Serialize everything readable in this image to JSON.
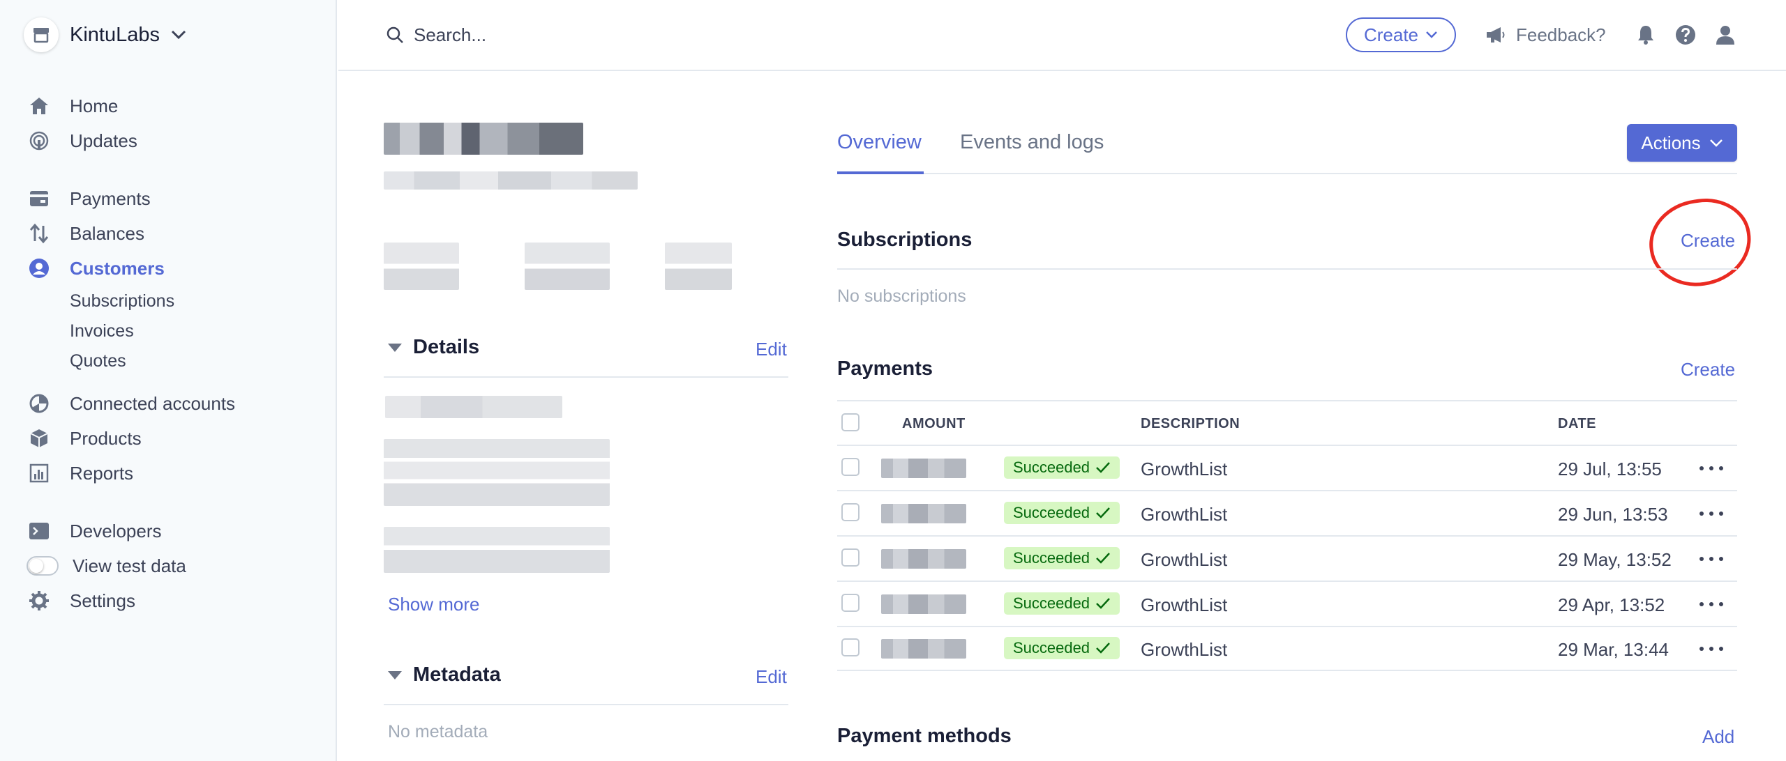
{
  "account": {
    "name": "KintuLabs"
  },
  "nav": {
    "primary": [
      {
        "label": "Home",
        "icon": "home-icon"
      },
      {
        "label": "Updates",
        "icon": "updates-icon"
      }
    ],
    "secondary": [
      {
        "label": "Payments",
        "icon": "payments-icon"
      },
      {
        "label": "Balances",
        "icon": "balances-icon"
      },
      {
        "label": "Customers",
        "icon": "customers-icon",
        "active": true
      }
    ],
    "customers_sub": [
      "Subscriptions",
      "Invoices",
      "Quotes"
    ],
    "tertiary": [
      {
        "label": "Connected accounts",
        "icon": "connected-accounts-icon"
      },
      {
        "label": "Products",
        "icon": "products-icon"
      },
      {
        "label": "Reports",
        "icon": "reports-icon"
      }
    ],
    "bottom": [
      {
        "label": "Developers",
        "icon": "developers-icon"
      },
      {
        "label": "View test data",
        "icon": "toggle"
      },
      {
        "label": "Settings",
        "icon": "gear-icon"
      }
    ]
  },
  "topbar": {
    "search_placeholder": "Search...",
    "create_label": "Create",
    "feedback_label": "Feedback?"
  },
  "customer": {
    "details": {
      "title": "Details",
      "edit": "Edit",
      "show_more": "Show more"
    },
    "metadata": {
      "title": "Metadata",
      "edit": "Edit",
      "empty": "No metadata"
    }
  },
  "tabs": [
    {
      "label": "Overview",
      "active": true
    },
    {
      "label": "Events and logs",
      "active": false
    }
  ],
  "actions_label": "Actions",
  "subscriptions": {
    "title": "Subscriptions",
    "create": "Create",
    "empty": "No subscriptions"
  },
  "payments": {
    "title": "Payments",
    "create": "Create",
    "columns": [
      "AMOUNT",
      "DESCRIPTION",
      "DATE"
    ],
    "rows": [
      {
        "status": "Succeeded",
        "description": "GrowthList",
        "date": "29 Jul, 13:55"
      },
      {
        "status": "Succeeded",
        "description": "GrowthList",
        "date": "29 Jun, 13:53"
      },
      {
        "status": "Succeeded",
        "description": "GrowthList",
        "date": "29 May, 13:52"
      },
      {
        "status": "Succeeded",
        "description": "GrowthList",
        "date": "29 Apr, 13:52"
      },
      {
        "status": "Succeeded",
        "description": "GrowthList",
        "date": "29 Mar, 13:44"
      }
    ]
  },
  "payment_methods": {
    "title": "Payment methods",
    "add": "Add"
  },
  "colors": {
    "accent": "#5469d4",
    "success_bg": "#d7f7c2",
    "success_fg": "#05690d",
    "annotation": "#ea2a21"
  }
}
